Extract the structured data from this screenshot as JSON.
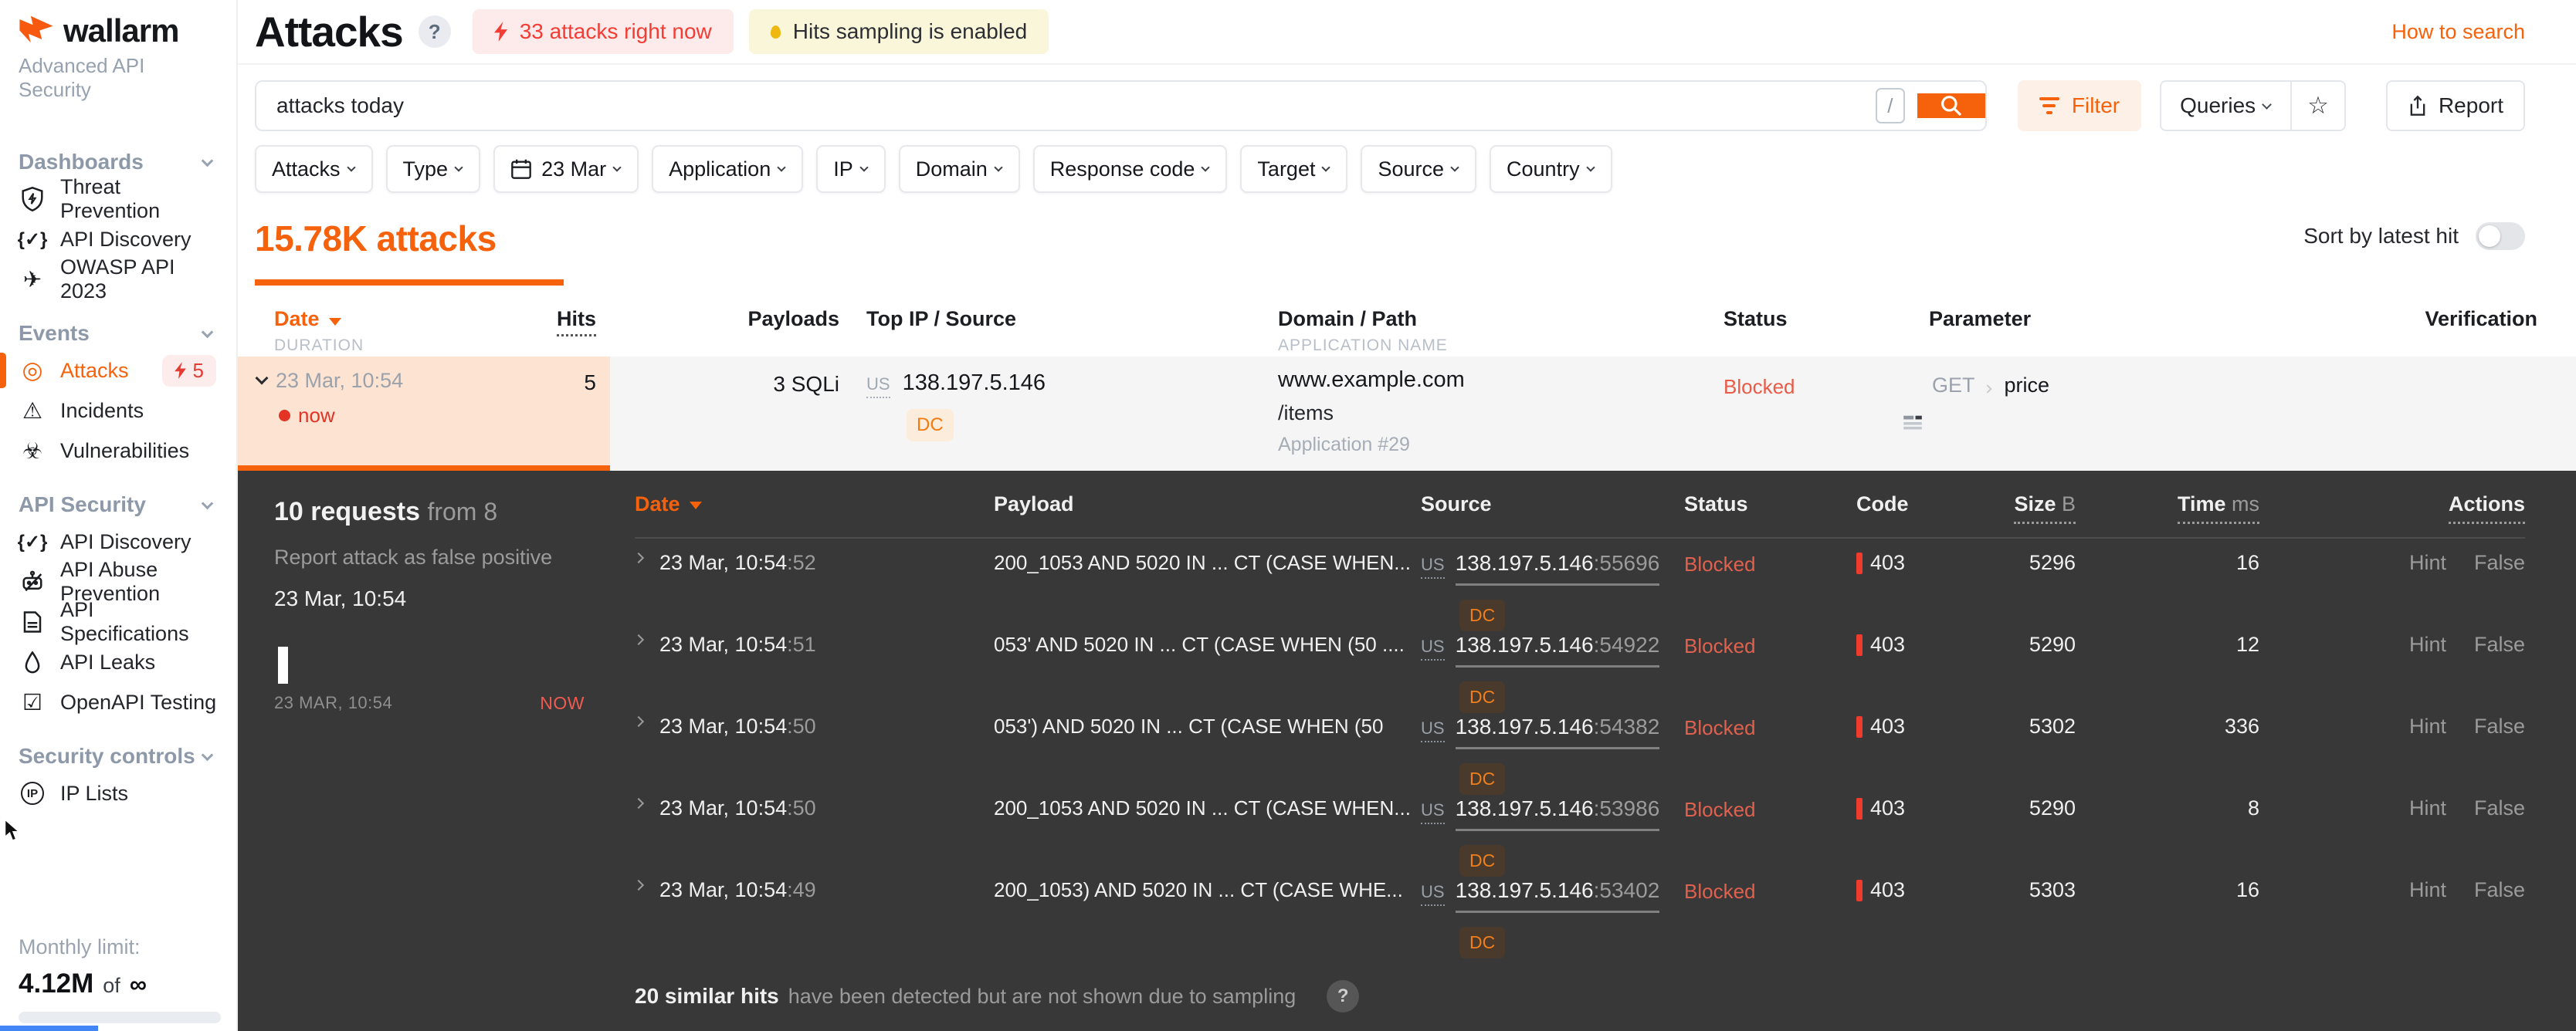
{
  "brand": {
    "name": "wallarm",
    "tagline": "Advanced API Security"
  },
  "icons": {
    "api_discovery": "{✓}",
    "owasp": "✈",
    "attacks_target": "◎",
    "incidents": "⚠",
    "vulnerabilities": "☣",
    "openapi_testing": "☑",
    "star": "☆",
    "ip": "IP",
    "help": "?"
  },
  "sidebar": {
    "sections": [
      {
        "label": "Dashboards",
        "items": [
          {
            "label": "Threat Prevention"
          },
          {
            "label": "API Discovery"
          },
          {
            "label": "OWASP API 2023"
          }
        ]
      },
      {
        "label": "Events",
        "items": [
          {
            "label": "Attacks",
            "badge": "5"
          },
          {
            "label": "Incidents"
          },
          {
            "label": "Vulnerabilities"
          }
        ]
      },
      {
        "label": "API Security",
        "items": [
          {
            "label": "API Discovery"
          },
          {
            "label": "API Abuse Prevention"
          },
          {
            "label": "API Specifications"
          },
          {
            "label": "API Leaks"
          },
          {
            "label": "OpenAPI Testing"
          }
        ]
      },
      {
        "label": "Security controls",
        "items": [
          {
            "label": "IP Lists"
          }
        ]
      }
    ],
    "monthly_limit": {
      "label": "Monthly limit:",
      "value": "4.12M",
      "of_label": "of",
      "limit": "∞"
    }
  },
  "header": {
    "title": "Attacks",
    "attacks_now": "33 attacks right now",
    "sampling": "Hits sampling is enabled",
    "how_to_search": "How to search"
  },
  "toolbar": {
    "search_value": "attacks today",
    "shortcut_key": "/",
    "filter": "Filter",
    "queries": "Queries",
    "report": "Report"
  },
  "filters": {
    "chips": [
      "Attacks",
      "Type",
      "23 Mar",
      "Application",
      "IP",
      "Domain",
      "Response code",
      "Target",
      "Source",
      "Country"
    ]
  },
  "summary": {
    "count": "15.78K attacks",
    "sort_label": "Sort by latest hit"
  },
  "attacks_table": {
    "headers": {
      "date": "Date",
      "duration": "DURATION",
      "hits": "Hits",
      "payloads": "Payloads",
      "source": "Top IP / Source",
      "domain": "Domain / Path",
      "application": "APPLICATION NAME",
      "status": "Status",
      "parameter": "Parameter",
      "verification": "Verification"
    },
    "row": {
      "date": "23 Mar, 10:54",
      "live": "now",
      "hits": "5",
      "payloads": "3 SQLi",
      "country": "US",
      "ip": "138.197.5.146",
      "tag": "DC",
      "domain": "www.example.com",
      "path": "/items",
      "application": "Application #29",
      "status": "Blocked",
      "method": "GET",
      "parameter": "price"
    }
  },
  "details": {
    "title": "10 requests",
    "title_suffix": "from 8",
    "report_link": "Report attack as false positive",
    "start_time": "23 Mar, 10:54",
    "timeline": {
      "start": "23 MAR, 10:54",
      "end": "NOW"
    },
    "headers": {
      "date": "Date",
      "payload": "Payload",
      "source": "Source",
      "status": "Status",
      "code": "Code",
      "size": "Size",
      "size_unit": "B",
      "time": "Time",
      "time_unit": "ms",
      "actions": "Actions"
    },
    "rows": [
      {
        "date": "23 Mar, 10:54",
        "seconds": ":52",
        "payload": "200_1053 AND 5020 IN ... CT (CASE WHEN...",
        "country": "US",
        "ip": "138.197.5.146",
        "port": ":55696",
        "tag": "DC",
        "status": "Blocked",
        "code": "403",
        "size": "5296",
        "time": "16",
        "action1": "Hint",
        "action2": "False"
      },
      {
        "date": "23 Mar, 10:54",
        "seconds": ":51",
        "payload": "053' AND 5020 IN ... CT (CASE WHEN (50 ....",
        "country": "US",
        "ip": "138.197.5.146",
        "port": ":54922",
        "tag": "DC",
        "status": "Blocked",
        "code": "403",
        "size": "5290",
        "time": "12",
        "action1": "Hint",
        "action2": "False"
      },
      {
        "date": "23 Mar, 10:54",
        "seconds": ":50",
        "payload": "053') AND 5020 IN ... CT (CASE WHEN (50",
        "country": "US",
        "ip": "138.197.5.146",
        "port": ":54382",
        "tag": "DC",
        "status": "Blocked",
        "code": "403",
        "size": "5302",
        "time": "336",
        "action1": "Hint",
        "action2": "False"
      },
      {
        "date": "23 Mar, 10:54",
        "seconds": ":50",
        "payload": "200_1053 AND 5020 IN ... CT (CASE WHEN...",
        "country": "US",
        "ip": "138.197.5.146",
        "port": ":53986",
        "tag": "DC",
        "status": "Blocked",
        "code": "403",
        "size": "5290",
        "time": "8",
        "action1": "Hint",
        "action2": "False"
      },
      {
        "date": "23 Mar, 10:54",
        "seconds": ":49",
        "payload": "200_1053) AND 5020 IN ... CT (CASE WHE...",
        "country": "US",
        "ip": "138.197.5.146",
        "port": ":53402",
        "tag": "DC",
        "status": "Blocked",
        "code": "403",
        "size": "5303",
        "time": "16",
        "action1": "Hint",
        "action2": "False"
      }
    ],
    "footer": {
      "bold": "20 similar hits",
      "rest": "have been detected but are not shown due to sampling"
    }
  }
}
